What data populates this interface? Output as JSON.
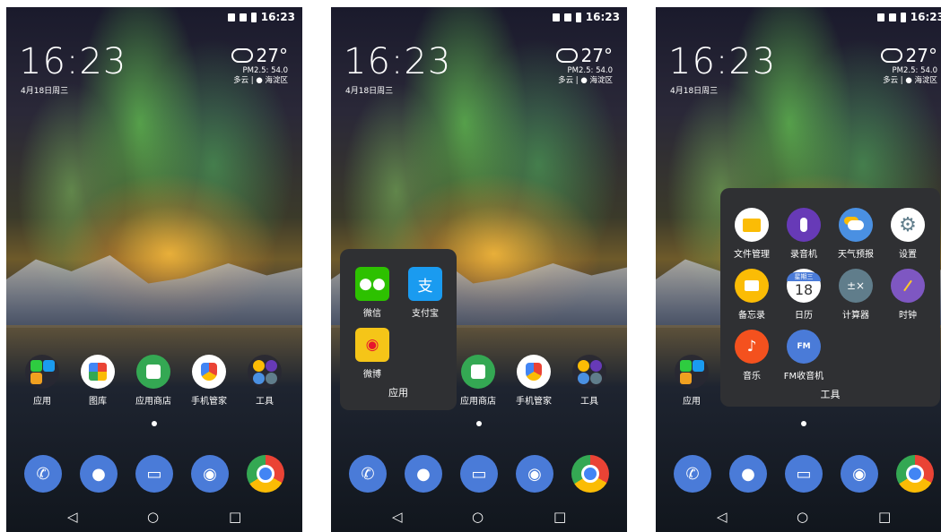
{
  "status": {
    "time": "16:23"
  },
  "lock": {
    "clock": "16:23",
    "date": "4月18日周三",
    "temp": "27°",
    "pm": "PM2.5: 54.0",
    "weather_loc": "多云 | ● 海淀区"
  },
  "home_apps": [
    "应用",
    "图库",
    "应用商店",
    "手机管家",
    "工具"
  ],
  "folder_apps": {
    "title": "应用",
    "items": [
      "微信",
      "支付宝",
      "微博"
    ]
  },
  "folder_tools": {
    "title": "工具",
    "items": [
      "文件管理",
      "录音机",
      "天气预报",
      "设置",
      "备忘录",
      "日历",
      "计算器",
      "时钟",
      "音乐",
      "FM收音机"
    ]
  },
  "calendar": {
    "weekday": "星期三",
    "day": "18"
  },
  "nav": {
    "back": "◁",
    "home": "○",
    "recent": "□"
  },
  "colors": {
    "folder_bg": "#2f3033",
    "accent_blue": "#4a7bd8"
  }
}
